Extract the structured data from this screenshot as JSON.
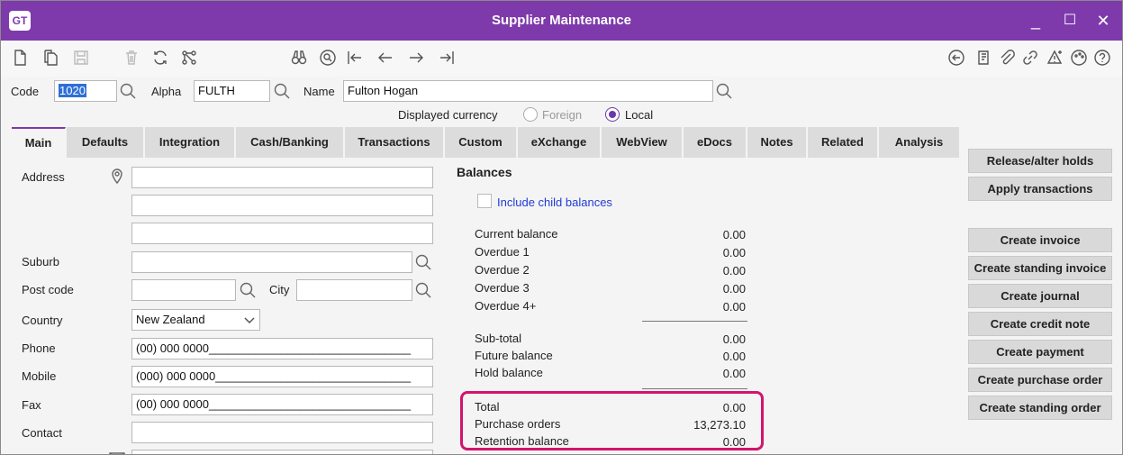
{
  "window": {
    "logo": "GT",
    "title": "Supplier Maintenance",
    "minimize": "_",
    "maximize": "☐",
    "close": "✕"
  },
  "header": {
    "code_label": "Code",
    "code_value": "1020",
    "alpha_label": "Alpha",
    "alpha_value": "FULTH",
    "name_label": "Name",
    "name_value": "Fulton Hogan",
    "currency_label": "Displayed currency",
    "currency_options": [
      "Foreign",
      "Local"
    ],
    "currency_selected": "Local"
  },
  "tabs": [
    "Main",
    "Defaults",
    "Integration",
    "Cash/Banking",
    "Transactions",
    "Custom",
    "eXchange",
    "WebView",
    "eDocs",
    "Notes",
    "Related",
    "Analysis"
  ],
  "active_tab": "Main",
  "form": {
    "address_label": "Address",
    "suburb_label": "Suburb",
    "postcode_label": "Post code",
    "city_label": "City",
    "country_label": "Country",
    "country_value": "New Zealand",
    "phone_label": "Phone",
    "phone_value": "(00) 000 0000_______________________________",
    "mobile_label": "Mobile",
    "mobile_value": "(000) 000 0000______________________________",
    "fax_label": "Fax",
    "fax_value": "(00) 000 0000_______________________________",
    "contact_label": "Contact"
  },
  "balances": {
    "heading": "Balances",
    "include_child": "Include child balances",
    "rows": [
      {
        "label": "Current balance",
        "value": "0.00"
      },
      {
        "label": "Overdue 1",
        "value": "0.00"
      },
      {
        "label": "Overdue 2",
        "value": "0.00"
      },
      {
        "label": "Overdue 3",
        "value": "0.00"
      },
      {
        "label": "Overdue 4+",
        "value": "0.00"
      }
    ],
    "subtotals": [
      {
        "label": "Sub-total",
        "value": "0.00"
      },
      {
        "label": "Future balance",
        "value": "0.00"
      },
      {
        "label": "Hold balance",
        "value": "0.00"
      }
    ],
    "totals": [
      {
        "label": "Total",
        "value": "0.00"
      },
      {
        "label": "Purchase orders",
        "value": "13,273.10"
      },
      {
        "label": "Retention balance",
        "value": "0.00"
      }
    ]
  },
  "actions": {
    "release_holds": "Release/alter holds",
    "apply_transactions": "Apply  transactions",
    "create": [
      "Create invoice",
      "Create standing invoice",
      "Create journal",
      "Create credit note",
      "Create payment",
      "Create purchase order",
      "Create standing order"
    ]
  },
  "colors": {
    "title_bar": "#7e3aab",
    "highlight": "#d3146f",
    "link": "#1f3bd6"
  }
}
